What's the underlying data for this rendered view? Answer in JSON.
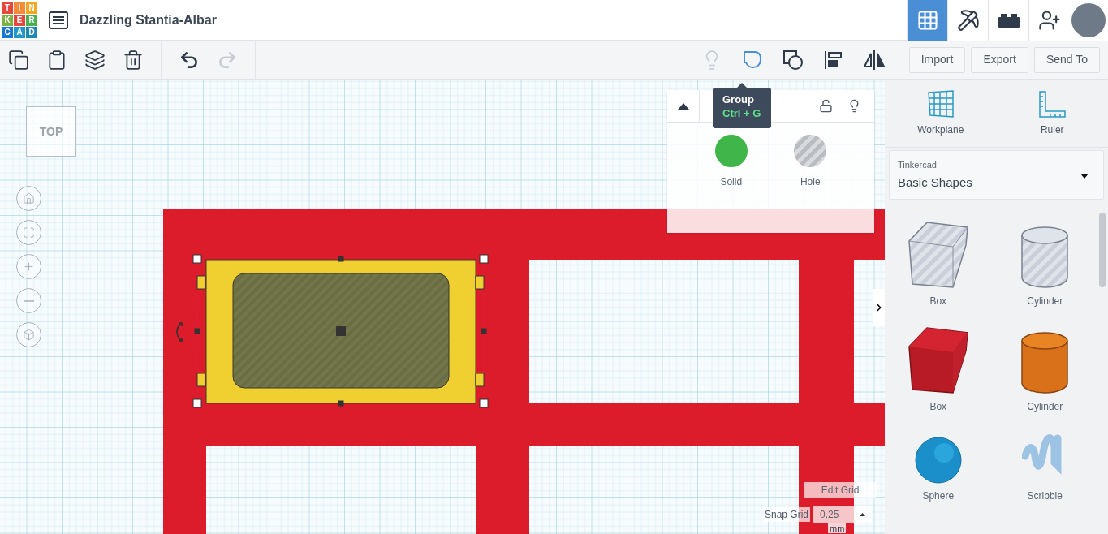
{
  "header": {
    "logo": [
      {
        "letter": "T",
        "color": "#e8453c"
      },
      {
        "letter": "I",
        "color": "#f28c38"
      },
      {
        "letter": "N",
        "color": "#f5a623"
      },
      {
        "letter": "K",
        "color": "#7cb342"
      },
      {
        "letter": "E",
        "color": "#e8453c"
      },
      {
        "letter": "R",
        "color": "#4caf50"
      },
      {
        "letter": "C",
        "color": "#1976d2"
      },
      {
        "letter": "A",
        "color": "#2196c9"
      },
      {
        "letter": "D",
        "color": "#1e88b5"
      }
    ],
    "title": "Dazzling Stantia-Albar",
    "views": [
      {
        "kind": "grid",
        "selected": true
      },
      {
        "kind": "pickaxe",
        "selected": false
      },
      {
        "kind": "bricks",
        "selected": false
      },
      {
        "kind": "user-add",
        "selected": false
      },
      {
        "kind": "avatar",
        "selected": false
      }
    ]
  },
  "toolbar": {
    "actions": [
      {
        "kind": "copy",
        "disabled": false
      },
      {
        "kind": "paste",
        "disabled": false
      },
      {
        "kind": "duplicate",
        "disabled": false
      },
      {
        "kind": "delete",
        "disabled": false
      },
      {
        "kind": "undo",
        "disabled": false
      },
      {
        "kind": "redo",
        "disabled": true
      }
    ],
    "tools": [
      {
        "kind": "light",
        "disabled": true,
        "selected": false
      },
      {
        "kind": "group",
        "disabled": false,
        "selected": true
      },
      {
        "kind": "ungroup",
        "disabled": false,
        "selected": false
      },
      {
        "kind": "align",
        "disabled": false,
        "selected": false
      },
      {
        "kind": "mirror",
        "disabled": false,
        "selected": false
      }
    ],
    "buttons": [
      "Import",
      "Export",
      "Send To"
    ]
  },
  "tooltip": {
    "title": "Group",
    "shortcut": "Ctrl + G"
  },
  "inspector": {
    "expanded": true,
    "locked": false,
    "options": [
      {
        "kind": "solid",
        "label": "Solid",
        "selected": false
      },
      {
        "kind": "hole",
        "label": "Hole",
        "selected": false
      }
    ]
  },
  "view_cube": "TOP",
  "view_controls": [
    {
      "kind": "home"
    },
    {
      "kind": "fit"
    },
    {
      "kind": "zoom-in"
    },
    {
      "kind": "zoom-out"
    },
    {
      "kind": "perspective"
    }
  ],
  "grid": {
    "edit_label": "Edit Grid",
    "snap_label": "Snap Grid",
    "snap_value": "0.25",
    "unit": "mm"
  },
  "panel": {
    "tools": [
      {
        "kind": "workplane",
        "label": "Workplane"
      },
      {
        "kind": "ruler",
        "label": "Ruler"
      }
    ],
    "library": {
      "source": "Tinkercad",
      "name": "Basic Shapes"
    },
    "shapes": [
      {
        "kind": "box-hole",
        "label": "Box"
      },
      {
        "kind": "cylinder-hole",
        "label": "Cylinder"
      },
      {
        "kind": "box",
        "label": "Box"
      },
      {
        "kind": "cylinder",
        "label": "Cylinder"
      },
      {
        "kind": "sphere",
        "label": "Sphere"
      },
      {
        "kind": "scribble",
        "label": "Scribble"
      }
    ]
  }
}
